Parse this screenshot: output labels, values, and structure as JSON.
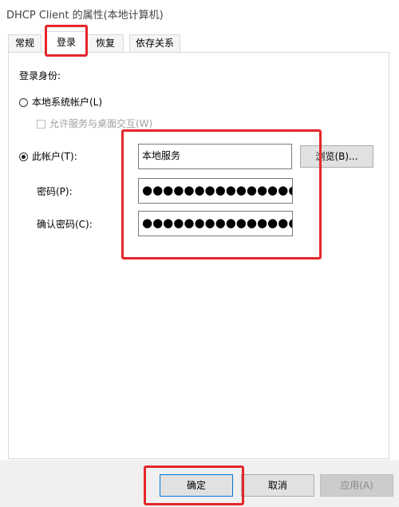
{
  "window": {
    "title": "DHCP Client 的属性(本地计算机)"
  },
  "tabs": [
    {
      "label": "常规"
    },
    {
      "label": "登录"
    },
    {
      "label": "恢复"
    },
    {
      "label": "依存关系"
    }
  ],
  "logon": {
    "section_title": "登录身份:",
    "local_system_account_label": "本地系统帐户(L)",
    "allow_desktop_interaction_label": "允许服务与桌面交互(W)",
    "this_account_label": "此帐户(T):",
    "account_value": "本地服务",
    "browse_button": "浏览(B)...",
    "password_label": "密码(P):",
    "password_value": "●●●●●●●●●●●●●●●",
    "confirm_password_label": "确认密码(C):",
    "confirm_password_value": "●●●●●●●●●●●●●●●",
    "selected_option": "this_account"
  },
  "buttons": {
    "ok": "确定",
    "cancel": "取消",
    "apply": "应用(A)"
  },
  "annotation_color": "#e5262a"
}
